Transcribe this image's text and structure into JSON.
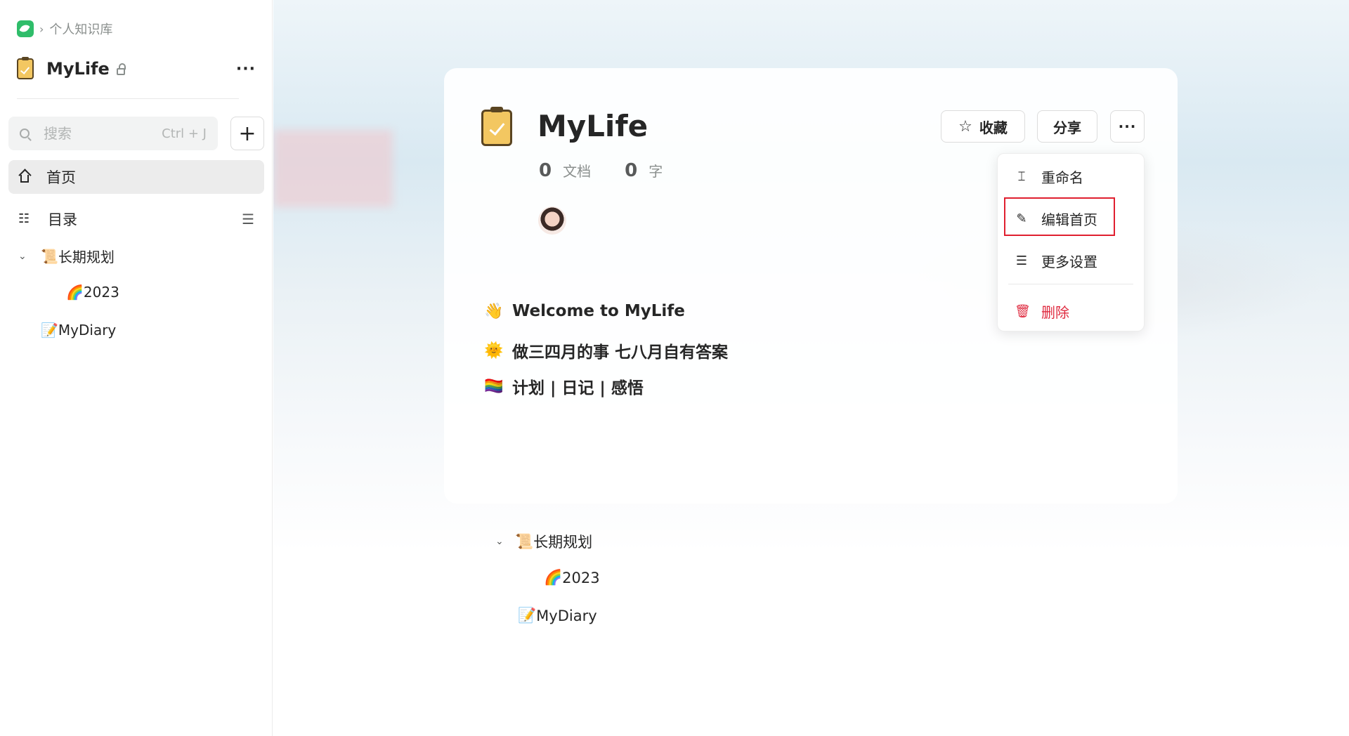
{
  "sidebar": {
    "breadcrumb": "个人知识库",
    "kb_name": "MyLife",
    "search_placeholder": "搜索",
    "search_shortcut": "Ctrl + J",
    "nav_home": "首页",
    "nav_toc": "目录",
    "tree": [
      {
        "emoji": "📜",
        "label": "长期规划"
      },
      {
        "emoji": "🌈",
        "label": "2023"
      },
      {
        "emoji": "📝",
        "label": "MyDiary"
      }
    ]
  },
  "main": {
    "title": "MyLife",
    "doc_count": "0",
    "doc_label": "文档",
    "word_count": "0",
    "word_label": "字",
    "favorite_label": "收藏",
    "share_label": "分享",
    "lines": [
      {
        "emoji": "👋",
        "text": "Welcome to MyLife"
      },
      {
        "emoji": "🌞",
        "text": "做三四月的事 七八月自有答案"
      },
      {
        "emoji": "🏳️‍🌈",
        "text": "计划 | 日记 | 感悟"
      }
    ],
    "tree": [
      {
        "emoji": "📜",
        "label": "长期规划"
      },
      {
        "emoji": "🌈",
        "label": "2023"
      },
      {
        "emoji": "📝",
        "label": "MyDiary"
      }
    ]
  },
  "menu": {
    "rename": "重命名",
    "edit_home": "编辑首页",
    "more_settings": "更多设置",
    "delete": "删除"
  },
  "colors": {
    "accent_green": "#2fbd6a",
    "danger": "#df2a3f",
    "highlight": "#e01f2f"
  }
}
